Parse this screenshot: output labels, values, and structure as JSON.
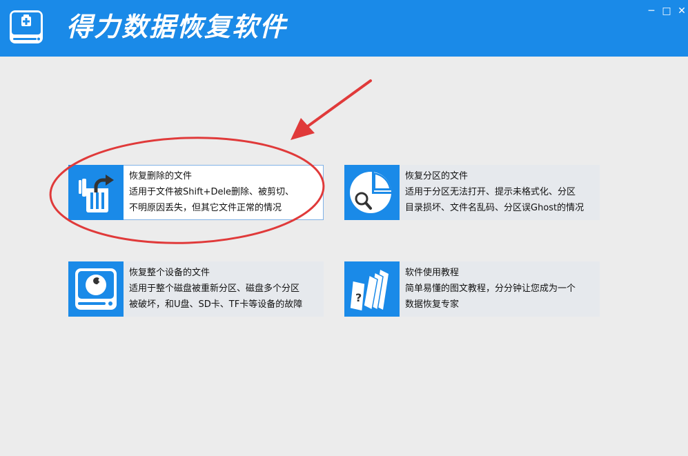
{
  "header": {
    "title": "得力数据恢复软件",
    "app_icon": "drive-medical-icon",
    "controls": {
      "minimize": "─",
      "maximize": "□",
      "close": "✕"
    }
  },
  "cards": [
    {
      "title": "恢复删除的文件",
      "line1": "适用于文件被Shift+Dele删除、被剪切、",
      "line2": "不明原因丢失，但其它文件正常的情况",
      "icon": "trash-restore-icon"
    },
    {
      "title": "恢复分区的文件",
      "line1": "适用于分区无法打开、提示未格式化、分区",
      "line2": "目录损坏、文件名乱码、分区误Ghost的情况",
      "icon": "partition-search-icon"
    },
    {
      "title": "恢复整个设备的文件",
      "line1": "适用于整个磁盘被重新分区、磁盘多个分区",
      "line2": "被破坏，和U盘、SD卡、TF卡等设备的故障",
      "icon": "disk-repair-icon"
    },
    {
      "title": "软件使用教程",
      "line1": "简单易懂的图文教程，分分钟让您成为一个",
      "line2": "数据恢复专家",
      "icon": "tutorial-pages-icon"
    }
  ],
  "colors": {
    "brand_blue": "#1a8ae8",
    "annotation_red": "#e03a3a",
    "background": "#ececec"
  },
  "annotation": {
    "arrow_icon": "red-arrow",
    "ellipse_icon": "red-ellipse-highlight"
  }
}
